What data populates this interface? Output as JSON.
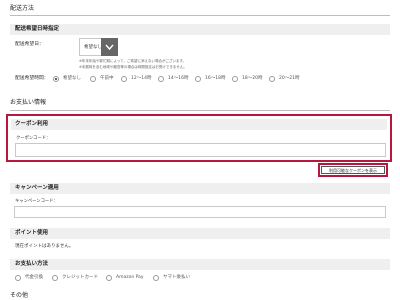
{
  "delivery_method": {
    "title": "配送方法"
  },
  "delivery_datetime": {
    "header": "配送希望日時指定",
    "date_label": "配送希望日：",
    "date_value": "希望なし",
    "notes": [
      "※年末年始や繁忙期によって、ご希望に添えない場合がございます。",
      "※未展時を含む地域や離島等の場合は時間指定はお受けできません。"
    ],
    "time_label": "配送希望時間：",
    "time_options": [
      "希望なし",
      "午前中",
      "12〜14時",
      "14〜16時",
      "16〜18時",
      "18〜20時",
      "20〜21時"
    ],
    "time_selected_index": 0
  },
  "payment_info": {
    "title": "お支払い情報"
  },
  "coupon": {
    "header": "クーポン利用",
    "code_label": "クーポンコード：",
    "code_value": "",
    "show_available_button": "利用可能なクーポンを表示"
  },
  "campaign": {
    "header": "キャンペーン適用",
    "code_label": "キャンペーンコード：",
    "code_value": ""
  },
  "points": {
    "header": "ポイント使用",
    "text": "現在ポイントはありません。"
  },
  "payment_method": {
    "header": "お支払い方法",
    "options": [
      "代金引換",
      "クレジットカード",
      "Amazon Pay",
      "ヤマト後払い"
    ]
  },
  "other": {
    "title": "その他"
  },
  "colors": {
    "accent_red": "#b5173f",
    "band_gray": "#efefef",
    "select_button": "#666666"
  }
}
